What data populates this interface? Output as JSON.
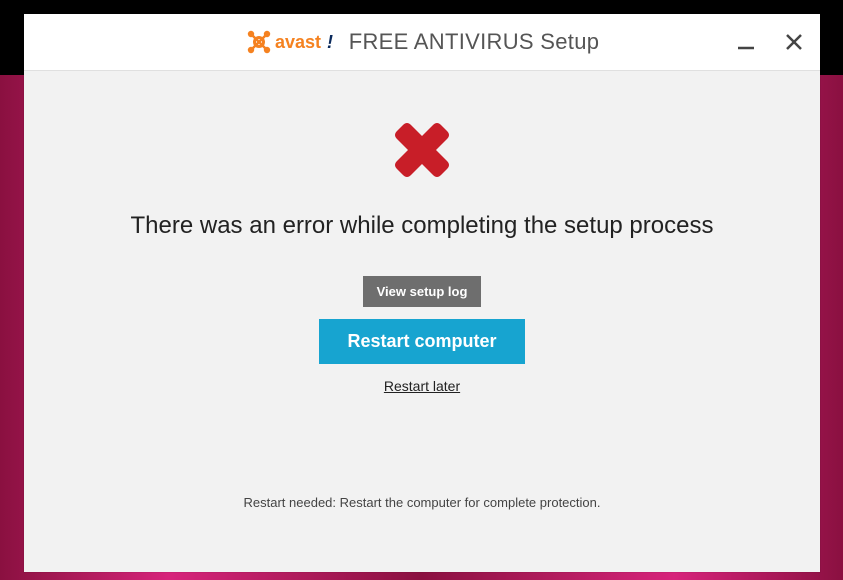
{
  "titlebar": {
    "suffix": " FREE ANTIVIRUS Setup"
  },
  "main": {
    "error_heading": "There was an error while completing the setup process",
    "view_log_label": "View setup log",
    "restart_label": "Restart computer",
    "restart_later_label": "Restart later"
  },
  "footer": {
    "note": "Restart needed: Restart the computer for complete protection."
  },
  "icons": {
    "minimize": "minimize-icon",
    "close": "close-icon",
    "error": "error-x-icon",
    "brand": "avast-logo-icon"
  },
  "colors": {
    "accent": "#17a4d0",
    "error": "#c81e28",
    "brand_orange": "#f58220"
  }
}
